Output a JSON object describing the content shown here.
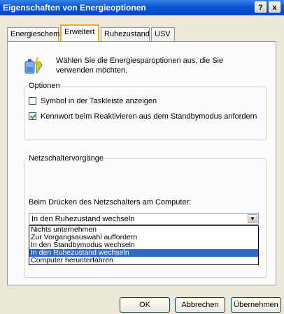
{
  "window": {
    "title": "Eigenschaften von Energieoptionen",
    "help_button": "?",
    "close_button": "x"
  },
  "tabs": [
    {
      "label": "Energieschemas"
    },
    {
      "label": "Erweitert"
    },
    {
      "label": "Ruhezustand"
    },
    {
      "label": "USV"
    }
  ],
  "intro_text": "Wählen Sie die Energiesparoptionen aus, die Sie verwenden möchten.",
  "options_group": {
    "legend": "Optionen",
    "show_taskbar_icon": {
      "label": "Symbol in der Taskleiste anzeigen",
      "checked": false
    },
    "password_on_resume": {
      "label": "Kennwort beim Reaktivieren aus dem Standbymodus anfordern",
      "checked": true
    }
  },
  "power_button_group": {
    "legend": "Netzschaltervorgänge",
    "press_label": "Beim Drücken des Netzschalters am Computer:",
    "selected_value": "In den Ruhezustand wechseln",
    "options": [
      "Nichts unternehmen",
      "Zur Vorgangsauswahl auffordern",
      "In den Standbymodus wechseln",
      "In den Ruhezustand wechseln",
      "Computer herunterfahren"
    ],
    "highlighted_index": 3
  },
  "buttons": {
    "ok": "OK",
    "cancel": "Abbrechen",
    "apply": "Übernehmen"
  }
}
